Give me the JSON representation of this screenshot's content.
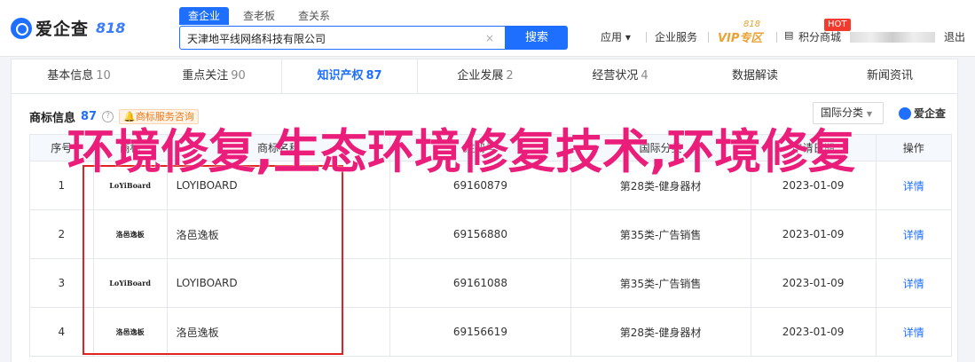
{
  "header": {
    "logo_text": "爱企查",
    "logo_818": "818",
    "search_tabs": [
      "查企业",
      "查老板",
      "查关系"
    ],
    "search_value": "天津地平线网络科技有限公司",
    "search_clear": "×",
    "search_button": "搜索",
    "nav_app": "应用 ▾",
    "nav_service": "企业服务",
    "nav_vip": "VIP专区",
    "nav_vip_818": "818",
    "nav_points": "积分商城",
    "nav_hot": "HOT",
    "nav_logout": "退出"
  },
  "tabs": [
    {
      "label": "基本信息",
      "count": "10"
    },
    {
      "label": "重点关注",
      "count": "90"
    },
    {
      "label": "知识产权",
      "count": "87"
    },
    {
      "label": "企业发展",
      "count": "2"
    },
    {
      "label": "经营状况",
      "count": "4"
    },
    {
      "label": "数据解读",
      "count": ""
    },
    {
      "label": "新闻资讯",
      "count": ""
    }
  ],
  "section": {
    "title": "商标信息",
    "count": "87",
    "help": "?",
    "consult": "商标服务咨询",
    "filter": "国际分类",
    "brand": "爱企查"
  },
  "table": {
    "headers": [
      "序号",
      "商标",
      "商标名称",
      "注册号",
      "国际分类",
      "申请日期",
      "操作"
    ],
    "rows": [
      {
        "no": "1",
        "img": "LoYiBoard",
        "name": "LOYIBOARD",
        "reg": "69160879",
        "cls": "第28类-健身器材",
        "date": "2023-01-09",
        "action": "详情"
      },
      {
        "no": "2",
        "img": "洛邑逸板",
        "name": "洛邑逸板",
        "reg": "69156880",
        "cls": "第35类-广告销售",
        "date": "2023-01-09",
        "action": "详情"
      },
      {
        "no": "3",
        "img": "LoYiBoard",
        "name": "LOYIBOARD",
        "reg": "69161088",
        "cls": "第35类-广告销售",
        "date": "2023-01-09",
        "action": "详情"
      },
      {
        "no": "4",
        "img": "洛邑逸板",
        "name": "洛邑逸板",
        "reg": "69156619",
        "cls": "第28类-健身器材",
        "date": "2023-01-09",
        "action": "详情"
      }
    ]
  },
  "overlay": {
    "title": "环境修复,生态环境修复技术,环境修复"
  }
}
